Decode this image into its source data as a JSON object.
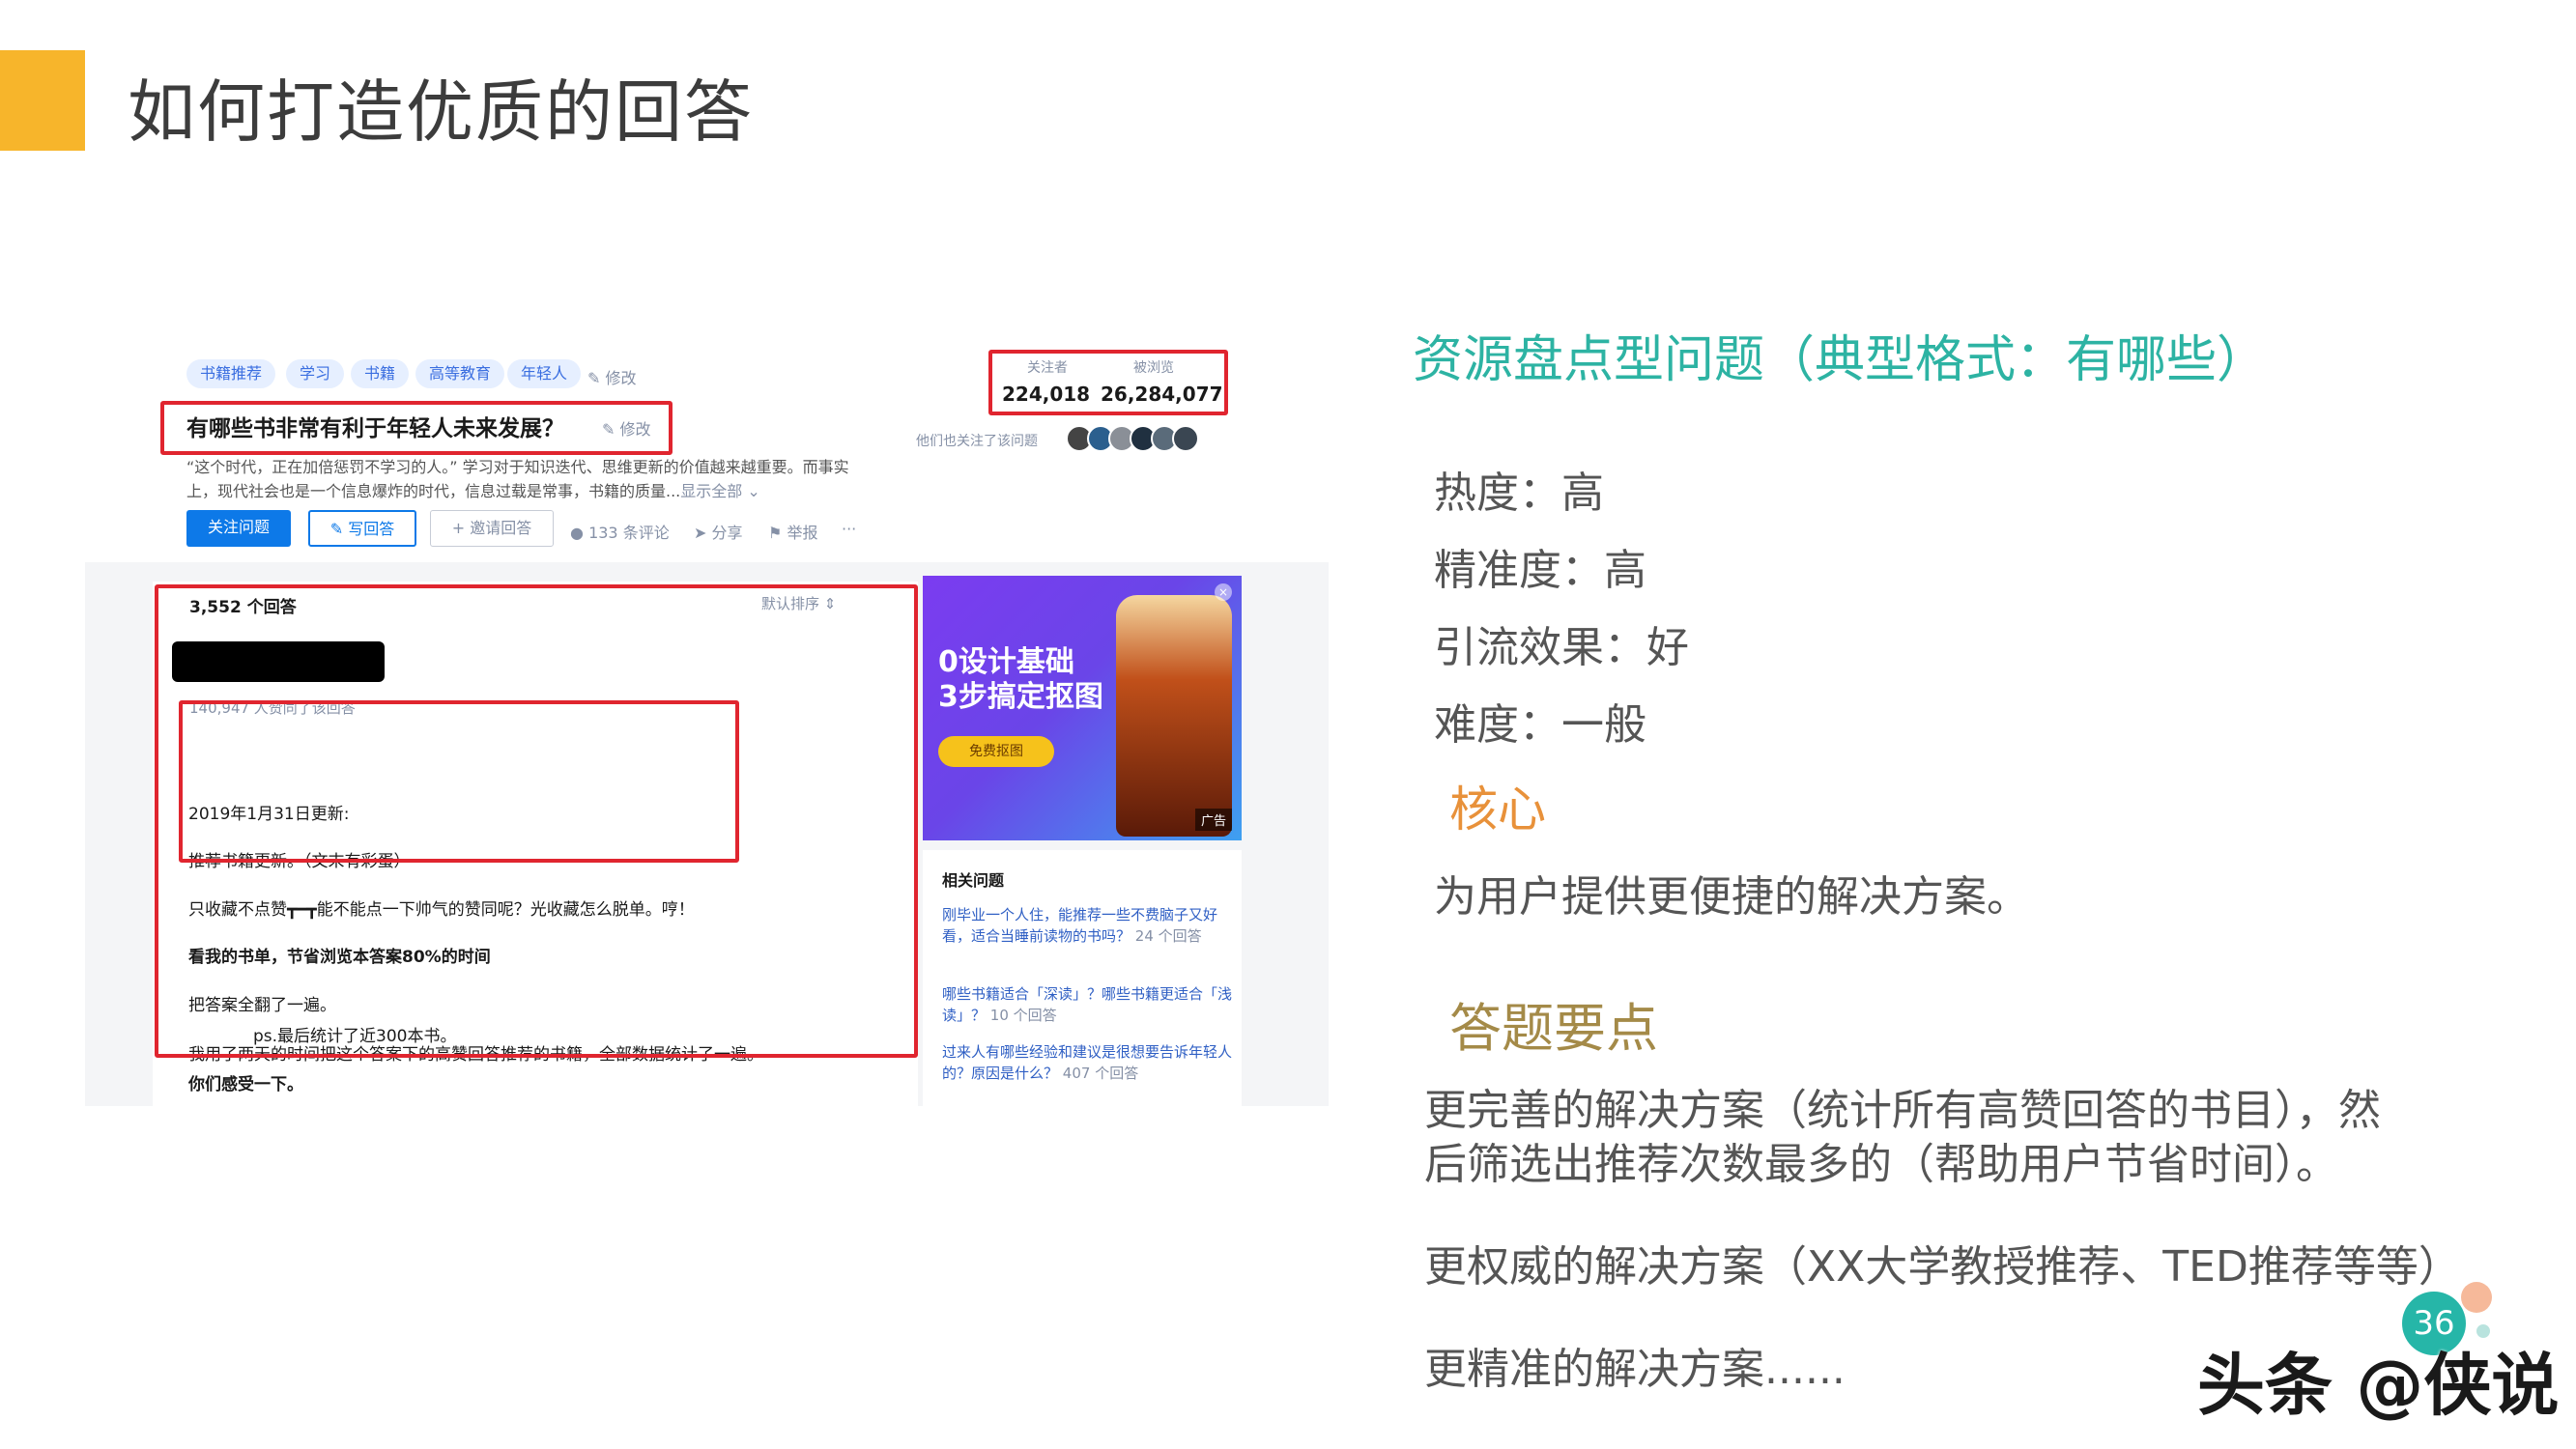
{
  "slide": {
    "title": "如何打造优质的回答",
    "accent_color": "#f7b52b",
    "page_number": "36",
    "watermark": "头条 @侠说"
  },
  "screenshot": {
    "tags": [
      "书籍推荐",
      "学习",
      "书籍",
      "高等教育",
      "年轻人"
    ],
    "tag_edit": "修改",
    "stats": {
      "followers_label": "关注者",
      "followers_value": "224,018",
      "views_label": "被浏览",
      "views_value": "26,284,077"
    },
    "followers_hint": "他们也关注了该问题",
    "question_title": "有哪些书非常有利于年轻人未来发展？",
    "title_edit": "修改",
    "description_line1": "“这个时代，正在加倍惩罚不学习的人。” 学习对于知识迭代、思维更新的价值越来越重要。而事实",
    "description_line2": "上，现代社会也是一个信息爆炸的时代，信息过载是常事，书籍的质量...",
    "show_all": "显示全部 ⌄",
    "buttons": {
      "follow": "关注问题",
      "write_answer": "写回答",
      "invite": "邀请回答"
    },
    "actions": {
      "comments": "133 条评论",
      "share": "分享",
      "report": "举报",
      "more": "···"
    },
    "answers": {
      "count": "3,552 个回答",
      "sort": "默认排序",
      "likes": "140,947 人赞同了该回答",
      "lines": [
        "2019年1月31日更新:",
        "推荐书籍更新。（文末有彩蛋）",
        "只收藏不点赞┳━┳能不能点一下帅气的赞同呢？光收藏怎么脱单。哼！",
        "看我的书单，节省浏览本答案80%的时间",
        "把答案全翻了一遍。",
        "我用了两天的时间把这个答案下的高赞回答推荐的书籍，全部数据统计了一遍。",
        "ps.最后统计了近300本书。",
        "你们感受一下。"
      ]
    },
    "ad": {
      "headline_1": "0设计基础",
      "headline_2": "3步搞定抠图",
      "button": "免费抠图",
      "tag": "广告",
      "close": "×"
    },
    "related": {
      "title": "相关问题",
      "items": [
        {
          "q": "刚毕业一个人住，能推荐一些不费脑子又好看，适合当睡前读物的书吗？",
          "count": "24 个回答"
        },
        {
          "q": "哪些书籍适合「深读」？哪些书籍更适合「浅读」？",
          "count": "10 个回答"
        },
        {
          "q": "过来人有哪些经验和建议是很想要告诉年轻人的？原因是什么？",
          "count": "407 个回答"
        }
      ]
    }
  },
  "analysis": {
    "heading": "资源盘点型问题（典型格式：有哪些）",
    "metrics": [
      "热度：高",
      "精准度：高",
      "引流效果：好",
      "难度：一般"
    ],
    "core_label": "核心",
    "core_text": "为用户提供更便捷的解决方案。",
    "points_label": "答题要点",
    "point_1a": "更完善的解决方案（统计所有高赞回答的书目），然",
    "point_1b": "后筛选出推荐次数最多的（帮助用户节省时间）。",
    "point_2": "更权威的解决方案（XX大学教授推荐、TED推荐等等）",
    "point_3": "更精准的解决方案......"
  }
}
